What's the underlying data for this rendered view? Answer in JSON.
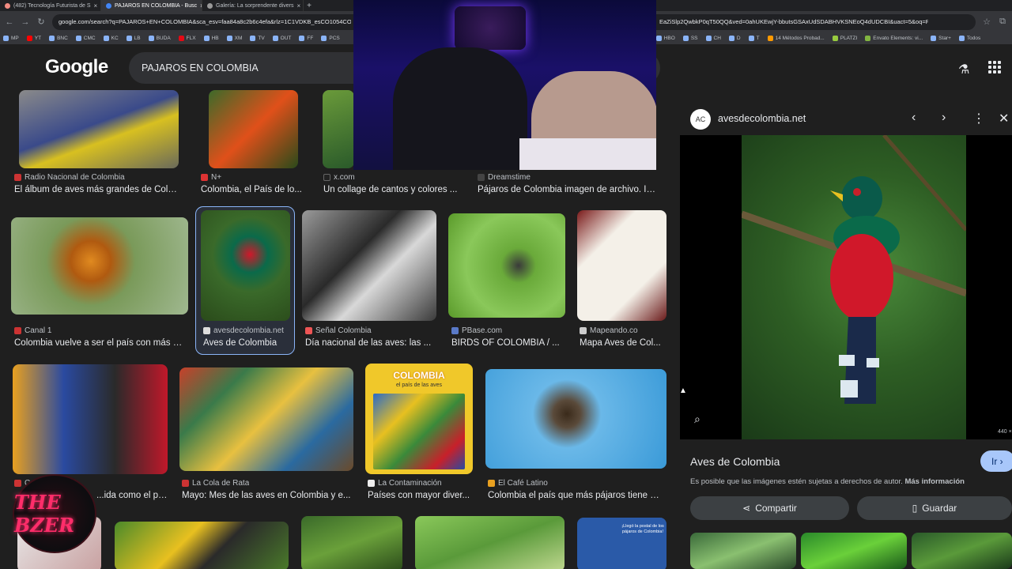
{
  "browser": {
    "tabs": [
      {
        "label": "(482) Tecnología Futurista de S",
        "active": false
      },
      {
        "label": "PAJAROS EN COLOMBIA - Busc",
        "active": true
      },
      {
        "label": "Galería: La sorprendente divers",
        "active": false
      }
    ],
    "url": "google.com/search?q=PAJAROS+EN+COLOMBIA&sca_esv=faa84a8c2b6c4efa&rlz=1C1VDKB_esCO1054CO1054",
    "url_tail": "EaZiSlp2QwbkP0qT50QQ&ved=0ahUKEwjY-bbutsGSAxUdSDABHVKSNEoQ4dUDCBI&uact=5&oq=PA...",
    "bookmarks_left": [
      "MP",
      "YT",
      "BNC",
      "CMC",
      "KC",
      "LB",
      "BUDA",
      "FLX",
      "HB",
      "XM",
      "TV",
      "OUT",
      "FF",
      "PCS"
    ],
    "bookmarks_right": [
      "HBO",
      "SS",
      "CH",
      "D",
      "T",
      "14 Métodos Probad...",
      "PLATZI",
      "Envato Elements: vi...",
      "Star+",
      "Todos"
    ]
  },
  "google": {
    "logo": "Google",
    "query": "PAJAROS EN COLOMBIA"
  },
  "results": [
    {
      "source": "Radio Nacional de Colombia",
      "title": "El álbum de aves más grandes de Colo..."
    },
    {
      "source": "N+",
      "title": "Colombia, el País de lo..."
    },
    {
      "source": "x.com",
      "title": "Un collage de cantos y colores ..."
    },
    {
      "source": "Dreamstime",
      "title": "Pájaros de Colombia imagen de archivo. Im..."
    },
    {
      "source": "Canal 1",
      "title": "Colombia vuelve a ser el país con más e..."
    },
    {
      "source": "avesdecolombia.net",
      "title": "Aves de Colombia"
    },
    {
      "source": "Señal Colombia",
      "title": "Día nacional de las aves: las ..."
    },
    {
      "source": "PBase.com",
      "title": "BIRDS OF COLOMBIA / ..."
    },
    {
      "source": "Mapeando.co",
      "title": "Mapa Aves de Col..."
    },
    {
      "source": "C...",
      "title": "...ida como el paí..."
    },
    {
      "source": "La Cola de Rata",
      "title": "Mayo: Mes de las aves en Colombia y e..."
    },
    {
      "source": "La Contaminación",
      "title": "Países con mayor diver..."
    },
    {
      "source": "El Café Latino",
      "title": "Colombia el país que más pájaros tiene e..."
    }
  ],
  "thumb_texts": {
    "colombia_poster_title": "COLOMBIA",
    "colombia_poster_sub": "el país de las aves",
    "postal_text": "¡Llegó la postal de los pájaros de Colombia!"
  },
  "stream_logo": "THE BZER",
  "panel": {
    "source_icon": "AC",
    "source": "avesdecolombia.net",
    "title": "Aves de Colombia",
    "go_label": "Ir",
    "copyright_note": "Es posible que las imágenes estén sujetas a derechos de autor.",
    "more_info": "Más información",
    "share_label": "Compartir",
    "save_label": "Guardar",
    "dims": "440 ×"
  }
}
